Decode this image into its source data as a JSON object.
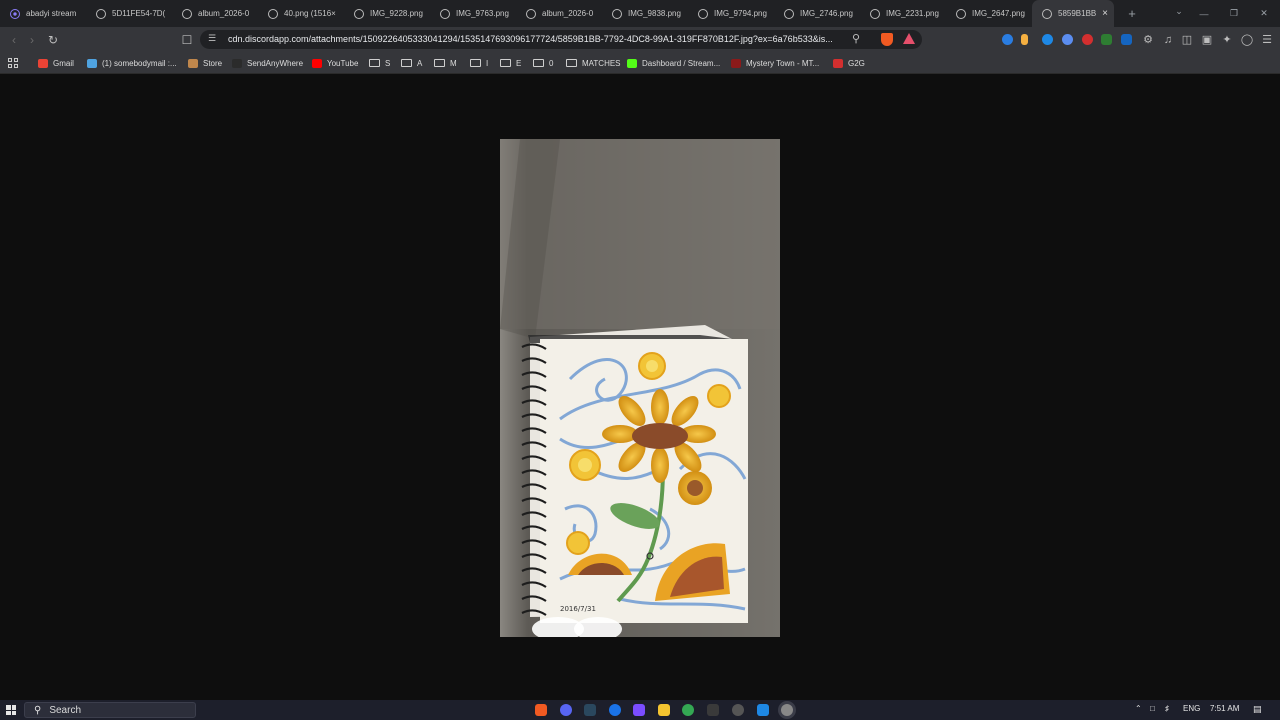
{
  "tabs": [
    {
      "label": "abadyi stream",
      "active": false
    },
    {
      "label": "5D11FE54-7D(",
      "active": false
    },
    {
      "label": "album_2026-0",
      "active": false
    },
    {
      "label": "40.png (1516×",
      "active": false
    },
    {
      "label": "IMG_9228.png",
      "active": false
    },
    {
      "label": "IMG_9763.png",
      "active": false
    },
    {
      "label": "album_2026-0",
      "active": false
    },
    {
      "label": "IMG_9838.png",
      "active": false
    },
    {
      "label": "IMG_9794.png",
      "active": false
    },
    {
      "label": "IMG_2746.png",
      "active": false
    },
    {
      "label": "IMG_2231.png",
      "active": false
    },
    {
      "label": "IMG_2647.png",
      "active": false
    },
    {
      "label": "5859B1BB",
      "active": true
    }
  ],
  "tab_close_glyph": "×",
  "new_tab_glyph": "+",
  "address_bar": {
    "url": "cdn.discordapp.com/attachments/1509226405333041294/1535147693096177724/5859B1BB-7792-4DC8-99A1-319FF870B12F.jpg?ex=6a76b533&is..."
  },
  "bookmarks": [
    {
      "label": "Gmail",
      "type": "site",
      "color": "#ea4335"
    },
    {
      "label": "(1) somebodymail :...",
      "type": "site",
      "color": "#4fa3e0"
    },
    {
      "label": "Store",
      "type": "site",
      "color": "#c0874c"
    },
    {
      "label": "SendAnyWhere",
      "type": "site",
      "color": "#2b2b2b"
    },
    {
      "label": "YouTube",
      "type": "site",
      "color": "#ff0000"
    },
    {
      "label": "S",
      "type": "folder"
    },
    {
      "label": "A",
      "type": "folder"
    },
    {
      "label": "M",
      "type": "folder"
    },
    {
      "label": "I",
      "type": "folder"
    },
    {
      "label": "E",
      "type": "folder"
    },
    {
      "label": "0",
      "type": "folder"
    },
    {
      "label": "MATCHES",
      "type": "folder"
    },
    {
      "label": "Dashboard / Stream...",
      "type": "site",
      "color": "#53fc18"
    },
    {
      "label": "Mystery Town - MT...",
      "type": "site",
      "color": "#8b1a1a"
    },
    {
      "label": "G2G",
      "type": "site",
      "color": "#d32f2f"
    }
  ],
  "image": {
    "caption_date": "2016/7/31",
    "subject": "spiral sketchbook with sunflower drawing"
  },
  "taskbar": {
    "search_placeholder": "Search",
    "language": "ENG",
    "time": "7:51 AM"
  },
  "colors": {
    "tab_bar": "#202124",
    "toolbar": "#35363a",
    "page_bg": "#0e0e0e",
    "taskbar": "#1d1f2b"
  }
}
